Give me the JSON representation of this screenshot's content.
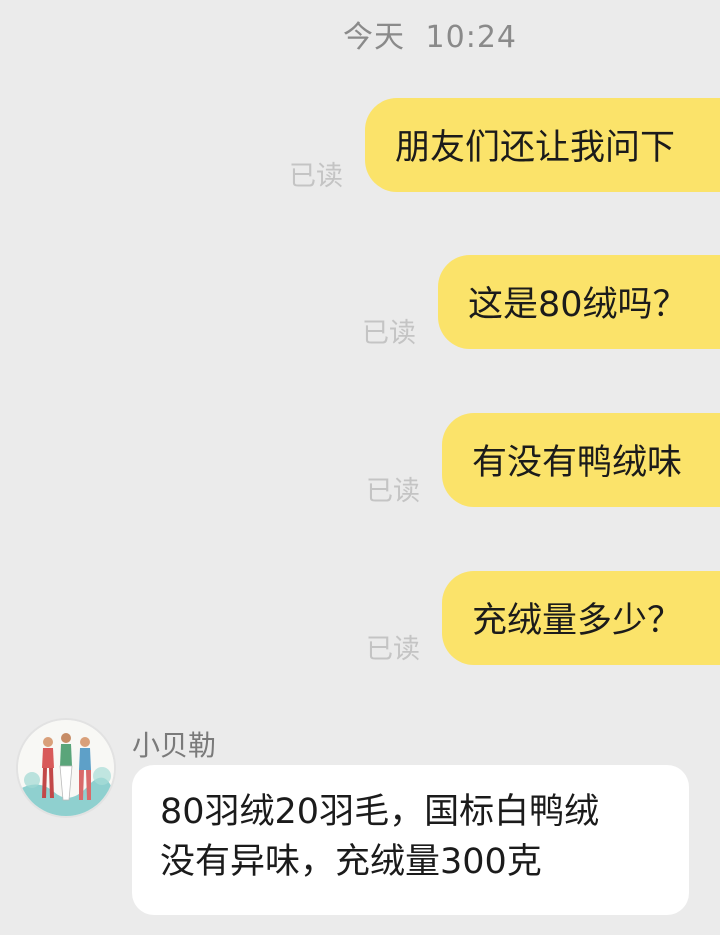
{
  "timestamp": {
    "day": "今天",
    "time": "10:24"
  },
  "outgoing": [
    {
      "text": "朋友们还让我问下",
      "status": "已读"
    },
    {
      "text": "这是80绒吗？",
      "status": "已读"
    },
    {
      "text": "有没有鸭绒味",
      "status": "已读"
    },
    {
      "text": "充绒量多少？",
      "status": "已读"
    }
  ],
  "incoming": {
    "sender": "小贝勒",
    "lines": [
      "80羽绒20羽毛，国标白鸭绒",
      "没有异味，充绒量300克"
    ]
  },
  "colors": {
    "background": "#ebebeb",
    "outgoing_bubble": "#fbe36a",
    "incoming_bubble": "#ffffff",
    "read_status": "#c4c4c4"
  }
}
